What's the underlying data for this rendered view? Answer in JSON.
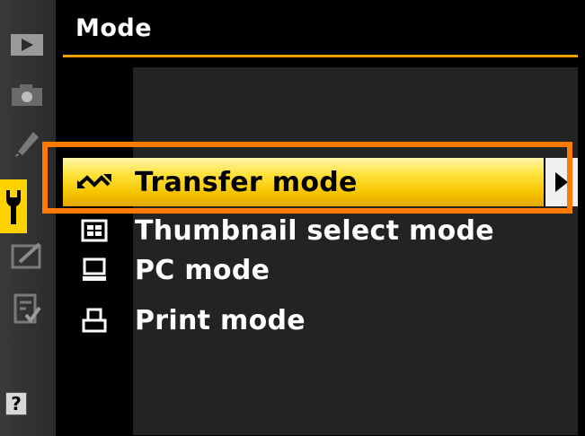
{
  "header": {
    "title": "Mode"
  },
  "sidebar": {
    "tabs": [
      {
        "icon": "playback-icon"
      },
      {
        "icon": "camera-icon"
      },
      {
        "icon": "pencil-icon"
      },
      {
        "icon": "wrench-icon",
        "active": true
      },
      {
        "icon": "retouch-icon"
      },
      {
        "icon": "my-menu-icon"
      }
    ],
    "help": "?"
  },
  "menu": {
    "items": [
      {
        "label": "Transfer mode",
        "icon": "transfer-icon",
        "selected": true
      },
      {
        "label": "Thumbnail select mode",
        "icon": "thumbnail-grid-icon"
      },
      {
        "label": "PC mode",
        "icon": "computer-icon"
      },
      {
        "label": "Print mode",
        "icon": "printer-icon"
      }
    ]
  },
  "colors": {
    "accent_orange": "#f5a000",
    "highlight_frame": "#ff7a00",
    "selection_yellow": "#ffd200"
  }
}
